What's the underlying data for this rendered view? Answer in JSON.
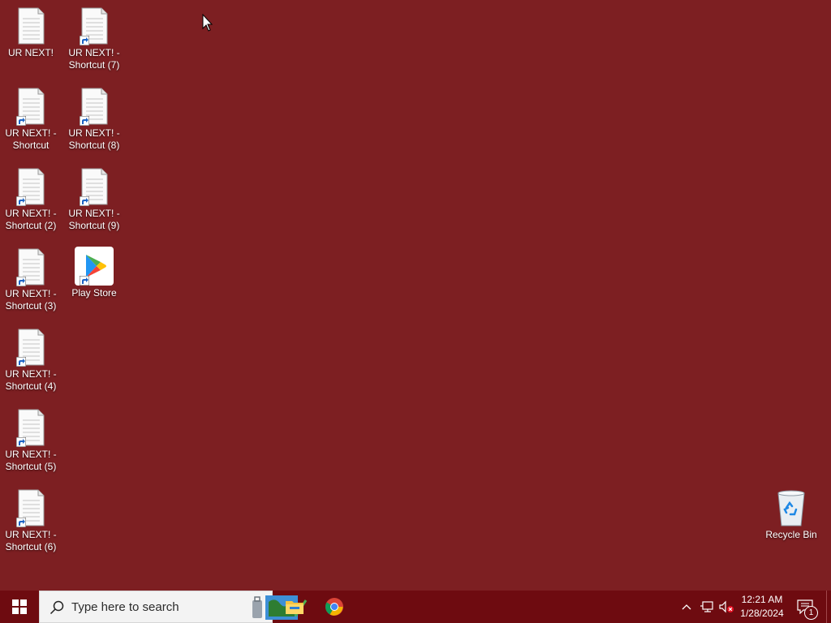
{
  "desktop": {
    "background_color": "#7d1f22",
    "icons": [
      {
        "label": "UR NEXT!",
        "type": "document",
        "shortcut": false
      },
      {
        "label": "UR NEXT! -\nShortcut",
        "type": "document",
        "shortcut": true
      },
      {
        "label": "UR NEXT! -\nShortcut (2)",
        "type": "document",
        "shortcut": true
      },
      {
        "label": "UR NEXT! -\nShortcut (3)",
        "type": "document",
        "shortcut": true
      },
      {
        "label": "UR NEXT! -\nShortcut (4)",
        "type": "document",
        "shortcut": true
      },
      {
        "label": "UR NEXT! -\nShortcut (5)",
        "type": "document",
        "shortcut": true
      },
      {
        "label": "UR NEXT! -\nShortcut (6)",
        "type": "document",
        "shortcut": true
      },
      {
        "label": "UR NEXT! -\nShortcut (7)",
        "type": "document",
        "shortcut": true
      },
      {
        "label": "UR NEXT! -\nShortcut (8)",
        "type": "document",
        "shortcut": true
      },
      {
        "label": "UR NEXT! -\nShortcut (9)",
        "type": "document",
        "shortcut": true
      },
      {
        "label": "Play Store",
        "type": "play-store",
        "shortcut": true
      },
      {
        "label": "Recycle Bin",
        "type": "recycle-bin",
        "shortcut": false
      }
    ]
  },
  "taskbar": {
    "color": "#6e0b10",
    "start_icon": "windows-logo-icon",
    "search": {
      "placeholder": "Type here to search",
      "icon": "search-icon"
    },
    "pinned_apps": [
      {
        "name": "File Explorer",
        "icon": "folder-icon"
      },
      {
        "name": "Google Chrome",
        "icon": "chrome-icon"
      }
    ],
    "tray": {
      "overflow_icon": "chevron-up-icon",
      "network_icon": "network-icon",
      "volume_icon": "volume-muted-icon",
      "time": "12:21 AM",
      "date": "1/28/2024",
      "notification_count": "1"
    }
  }
}
